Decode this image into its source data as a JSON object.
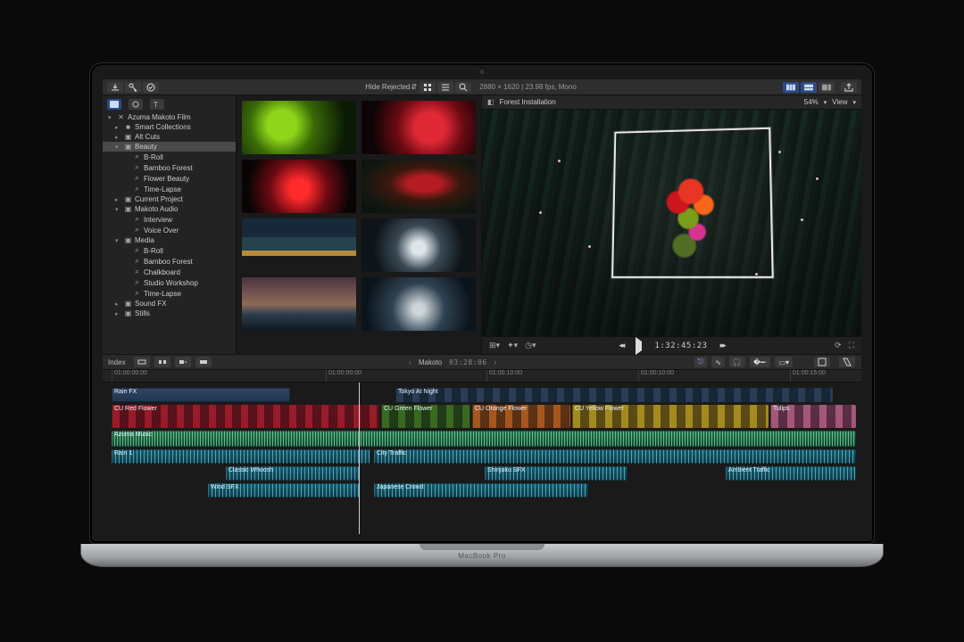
{
  "device_label": "MacBook Pro",
  "toolbar": {
    "hide_rejected": "Hide Rejected",
    "clip_info": "2880 × 1620 | 23.98 fps, Mono",
    "zoom_pct": "54%",
    "view_label": "View"
  },
  "sidebar": {
    "items": [
      {
        "tw": "▾",
        "ic": "✕",
        "label": "Azuma Makoto Film",
        "lvl": 0
      },
      {
        "tw": "▸",
        "ic": "■",
        "label": "Smart Collections",
        "lvl": 1
      },
      {
        "tw": "▸",
        "ic": "▣",
        "label": "Alt Cuts",
        "lvl": 1
      },
      {
        "tw": "▾",
        "ic": "▣",
        "label": "Beauty",
        "lvl": 1,
        "sel": true
      },
      {
        "tw": "",
        "ic": "⌕",
        "label": "B-Roll",
        "lvl": 2
      },
      {
        "tw": "",
        "ic": "⌕",
        "label": "Bamboo Forest",
        "lvl": 2
      },
      {
        "tw": "",
        "ic": "⌕",
        "label": "Flower Beauty",
        "lvl": 2
      },
      {
        "tw": "",
        "ic": "⌕",
        "label": "Time-Lapse",
        "lvl": 2
      },
      {
        "tw": "▸",
        "ic": "▣",
        "label": "Current Project",
        "lvl": 1
      },
      {
        "tw": "▾",
        "ic": "▣",
        "label": "Makoto Audio",
        "lvl": 1
      },
      {
        "tw": "",
        "ic": "⌕",
        "label": "Interview",
        "lvl": 2
      },
      {
        "tw": "",
        "ic": "⌕",
        "label": "Voice Over",
        "lvl": 2
      },
      {
        "tw": "▾",
        "ic": "▣",
        "label": "Media",
        "lvl": 1
      },
      {
        "tw": "",
        "ic": "⌕",
        "label": "B-Roll",
        "lvl": 2
      },
      {
        "tw": "",
        "ic": "⌕",
        "label": "Bamboo Forest",
        "lvl": 2
      },
      {
        "tw": "",
        "ic": "⌕",
        "label": "Chalkboard",
        "lvl": 2
      },
      {
        "tw": "",
        "ic": "⌕",
        "label": "Studio Workshop",
        "lvl": 2
      },
      {
        "tw": "",
        "ic": "⌕",
        "label": "Time-Lapse",
        "lvl": 2
      },
      {
        "tw": "▸",
        "ic": "▣",
        "label": "Sound FX",
        "lvl": 1
      },
      {
        "tw": "▸",
        "ic": "▣",
        "label": "Stills",
        "lvl": 1
      }
    ]
  },
  "viewer": {
    "title": "Forest Installation",
    "timecode": "1:32:45:23"
  },
  "timeline_bar": {
    "index_label": "Index",
    "project_name": "Makoto",
    "project_duration": "03:28:06"
  },
  "ruler_ticks": [
    "01:00:00:00",
    "01:00:00:00",
    "01:00:10:00",
    "01:00:10:00",
    "01:00:15:00"
  ],
  "clips": {
    "rain_fx": "Rain FX",
    "tokyo": "Tokyo At Night",
    "cu_red": "CU Red Flower",
    "cu_green": "CU Green Flower",
    "cu_orange": "CU Orange Flower",
    "cu_yellow": "CU Yellow Flower",
    "tulips": "Tulips",
    "azuma_music": "Azuma Music",
    "rain1": "Rain 1",
    "city_traffic": "City Traffic",
    "classic_whoosh": "Classic Whoosh",
    "shinjuku": "Shinjuku SFX",
    "ambient": "Ambient Traffic",
    "wind": "Wind SFX",
    "crowd": "Japanese Crowd"
  }
}
